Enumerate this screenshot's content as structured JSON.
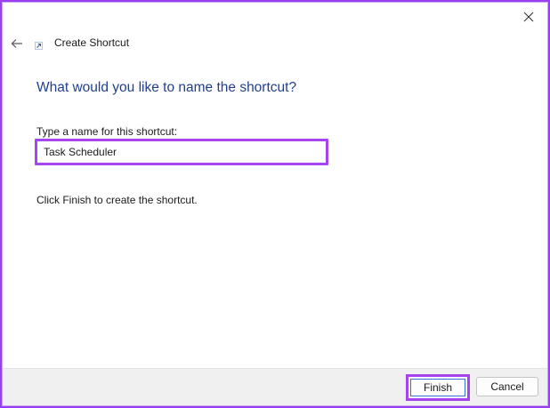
{
  "window": {
    "title": "Create Shortcut"
  },
  "main": {
    "heading": "What would you like to name the shortcut?",
    "name_label": "Type a name for this shortcut:",
    "name_value": "Task Scheduler",
    "hint": "Click Finish to create the shortcut."
  },
  "footer": {
    "finish_label": "Finish",
    "cancel_label": "Cancel"
  },
  "icons": {
    "close": "close-icon",
    "back": "back-arrow-icon",
    "shortcut": "shortcut-icon"
  },
  "colors": {
    "heading": "#1f3f8f",
    "highlight": "#a544f0",
    "primary_button_border": "#3a6fd8"
  }
}
